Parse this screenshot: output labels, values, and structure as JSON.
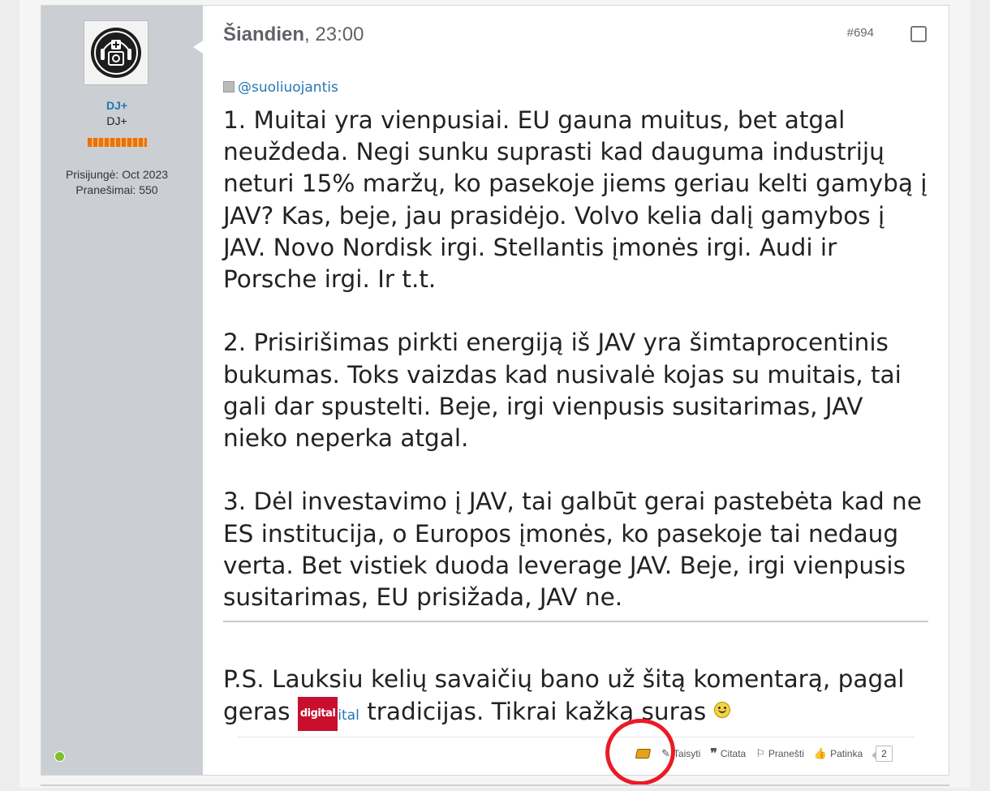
{
  "post": {
    "date_bold": "Šiandien",
    "date_rest": ", 23:00",
    "number": "#694",
    "mention": "@suoliuojantis",
    "paragraphs": [
      "1. Muitai yra vienpusiai. EU gauna muitus, bet atgal neuždeda. Negi sunku suprasti kad dauguma industrijų neturi 15% maržų, ko pasekoje jiems geriau kelti gamybą į JAV? Kas, beje, jau prasidėjo. Volvo kelia dalį gamybos į JAV. Novo Nordisk irgi. Stellantis įmonės irgi. Audi ir Porsche irgi. Ir t.t.",
      "2. Prisirišimas pirkti energiją iš JAV yra šimtaprocentinis bukumas. Toks vaizdas kad nusivalė kojas su muitais, tai gali dar spustelti. Beje, irgi vienpusis susitarimas, JAV nieko neperka atgal.",
      "3. Dėl investavimo į JAV, tai galbūt gerai pastebėta kad ne ES institucija, o Europos įmonės, ko pasekoje tai nedaug verta. Bet vistiek duoda leverage JAV. Beje, irgi vienpusis susitarimas, EU prisižada, JAV ne."
    ],
    "ps_before": "P.S. Lauksiu kelių savaičių bano už šitą komentarą, pagal geras ",
    "ps_badge": "digital",
    "ps_link": "ital",
    "ps_after": " tradicijas. Tikrai kažką suras ",
    "actions": {
      "edit": "Taisyti",
      "quote": "Citata",
      "report": "Pranešti",
      "like": "Patinka",
      "like_count": "2"
    }
  },
  "user": {
    "name": "DJ+",
    "title": "DJ+",
    "joined": "Prisijungė: Oct 2023",
    "posts": "Pranešimai: 550",
    "online_color": "#7cc02b"
  },
  "colors": {
    "link": "#2577b1",
    "annotation": "#ea1b25",
    "sidebar": "#cbcfd4"
  }
}
